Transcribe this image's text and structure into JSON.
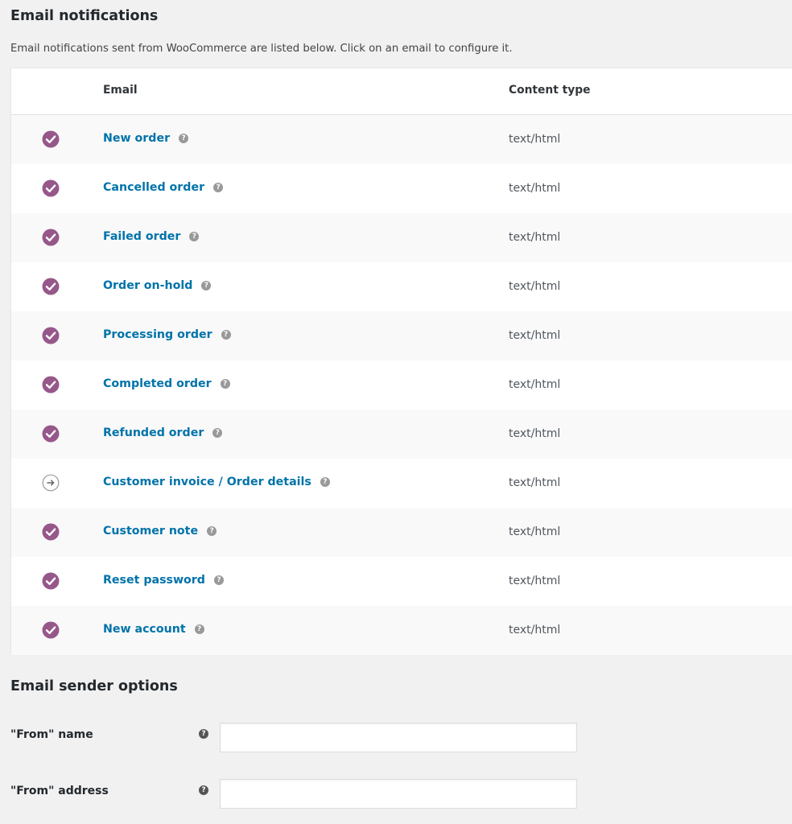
{
  "notifications": {
    "title": "Email notifications",
    "description": "Email notifications sent from WooCommerce are listed below. Click on an email to configure it.",
    "columns": {
      "email": "Email",
      "content_type": "Content type"
    },
    "help_glyph": "?",
    "rows": [
      {
        "name": "New order",
        "content_type": "text/html",
        "status": "enabled",
        "status_icon": "check-circle-icon"
      },
      {
        "name": "Cancelled order",
        "content_type": "text/html",
        "status": "enabled",
        "status_icon": "check-circle-icon"
      },
      {
        "name": "Failed order",
        "content_type": "text/html",
        "status": "enabled",
        "status_icon": "check-circle-icon"
      },
      {
        "name": "Order on-hold",
        "content_type": "text/html",
        "status": "enabled",
        "status_icon": "check-circle-icon"
      },
      {
        "name": "Processing order",
        "content_type": "text/html",
        "status": "enabled",
        "status_icon": "check-circle-icon"
      },
      {
        "name": "Completed order",
        "content_type": "text/html",
        "status": "enabled",
        "status_icon": "check-circle-icon"
      },
      {
        "name": "Refunded order",
        "content_type": "text/html",
        "status": "enabled",
        "status_icon": "check-circle-icon"
      },
      {
        "name": "Customer invoice / Order details",
        "content_type": "text/html",
        "status": "manual",
        "status_icon": "arrow-right-circle-icon"
      },
      {
        "name": "Customer note",
        "content_type": "text/html",
        "status": "enabled",
        "status_icon": "check-circle-icon"
      },
      {
        "name": "Reset password",
        "content_type": "text/html",
        "status": "enabled",
        "status_icon": "check-circle-icon"
      },
      {
        "name": "New account",
        "content_type": "text/html",
        "status": "enabled",
        "status_icon": "check-circle-icon"
      }
    ]
  },
  "sender": {
    "title": "Email sender options",
    "from_name": {
      "label": "\"From\" name",
      "value": ""
    },
    "from_address": {
      "label": "\"From\" address",
      "value": ""
    }
  },
  "colors": {
    "enabled_icon": "#96588a",
    "link": "#0073aa",
    "help_icon": "#999999",
    "manual_icon": "#999999"
  }
}
